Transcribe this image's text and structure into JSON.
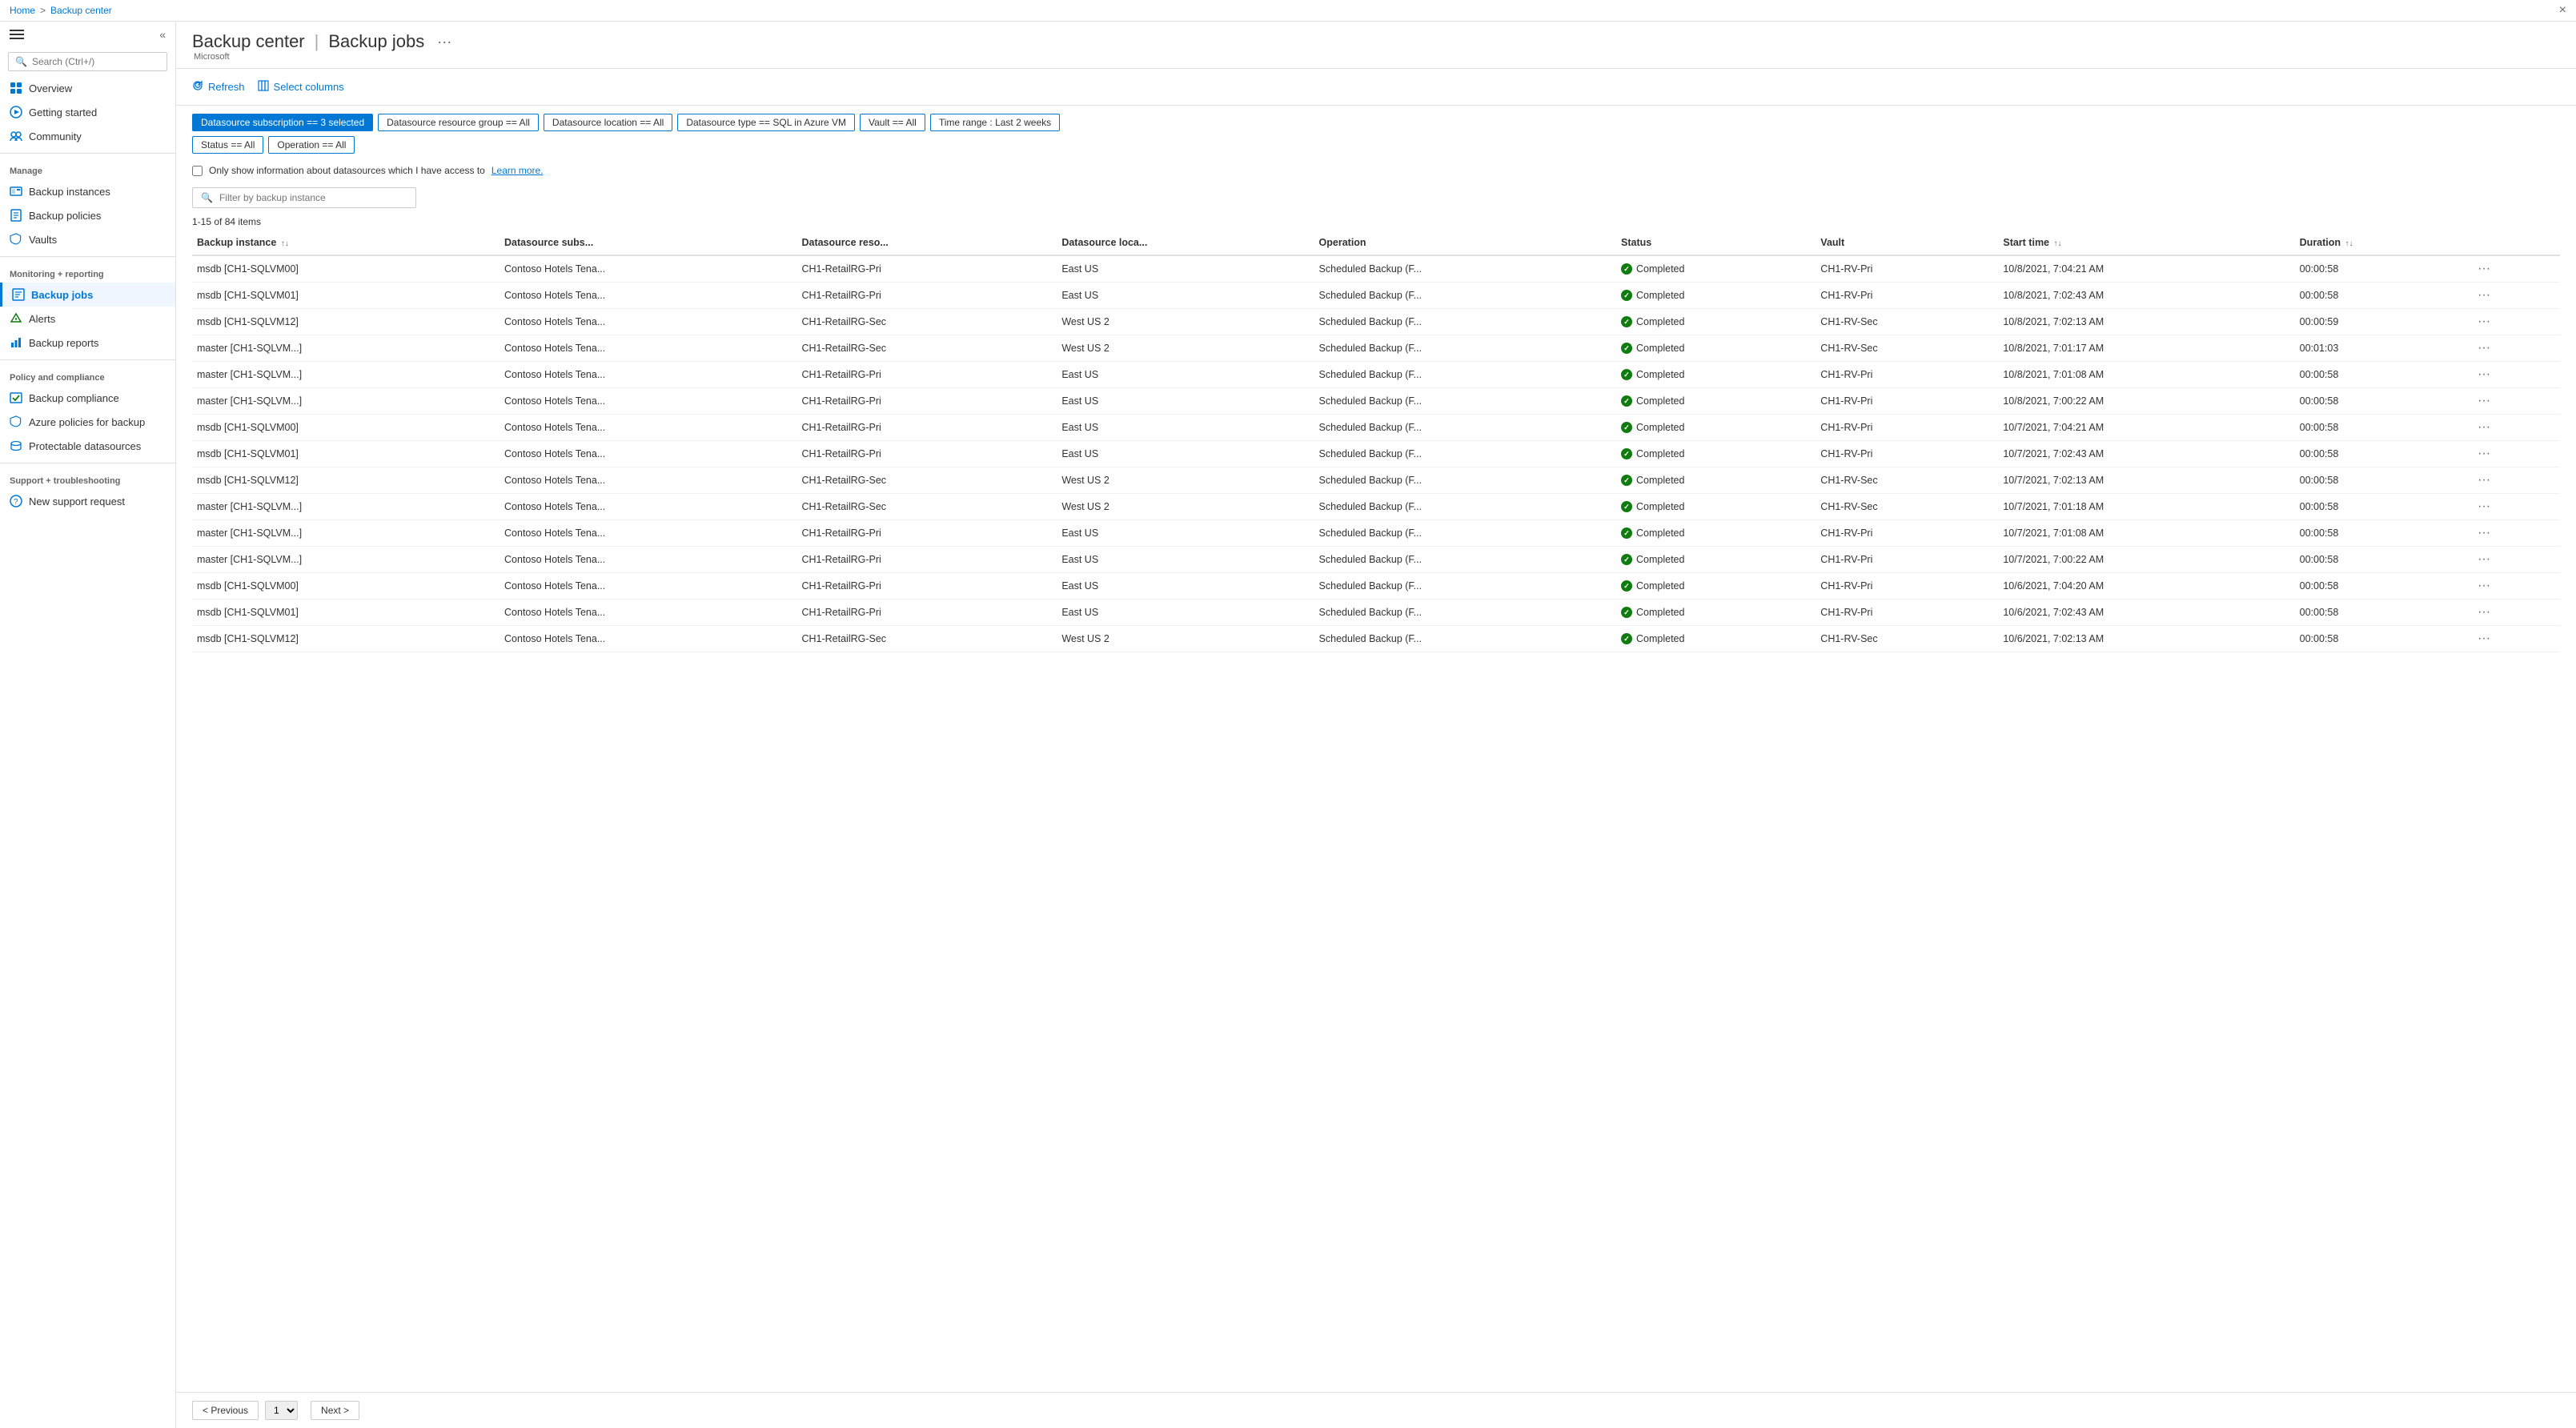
{
  "breadcrumb": {
    "home": "Home",
    "separator": ">",
    "current": "Backup center"
  },
  "close_button": "×",
  "page": {
    "title": "Backup center | Backup jobs",
    "title_part1": "Backup center",
    "separator": "|",
    "title_part2": "Backup jobs",
    "subtitle": "Microsoft",
    "more": "···"
  },
  "toolbar": {
    "refresh_label": "Refresh",
    "select_columns_label": "Select columns"
  },
  "filters": [
    {
      "label": "Datasource subscription == 3 selected",
      "active": true
    },
    {
      "label": "Datasource resource group == All",
      "active": false
    },
    {
      "label": "Datasource location == All",
      "active": false
    },
    {
      "label": "Datasource type == SQL in Azure VM",
      "active": false
    },
    {
      "label": "Vault == All",
      "active": false
    },
    {
      "label": "Time range : Last 2 weeks",
      "active": false
    },
    {
      "label": "Status == All",
      "active": false
    },
    {
      "label": "Operation == All",
      "active": false
    }
  ],
  "checkbox": {
    "label": "Only show information about datasources which I have access to",
    "link_text": "Learn more."
  },
  "filter_input": {
    "placeholder": "Filter by backup instance"
  },
  "count": "1-15 of 84 items",
  "table": {
    "columns": [
      {
        "label": "Backup instance",
        "sort": true
      },
      {
        "label": "Datasource subs...",
        "sort": false
      },
      {
        "label": "Datasource reso...",
        "sort": false
      },
      {
        "label": "Datasource loca...",
        "sort": false
      },
      {
        "label": "Operation",
        "sort": false
      },
      {
        "label": "Status",
        "sort": false
      },
      {
        "label": "Vault",
        "sort": false
      },
      {
        "label": "Start time",
        "sort": true
      },
      {
        "label": "Duration",
        "sort": true
      },
      {
        "label": "",
        "sort": false
      }
    ],
    "rows": [
      {
        "instance": "msdb [CH1-SQLVM00]",
        "subs": "Contoso Hotels Tena...",
        "rg": "CH1-RetailRG-Pri",
        "location": "East US",
        "operation": "Scheduled Backup (F...",
        "status": "Completed",
        "vault": "CH1-RV-Pri",
        "start_time": "10/8/2021, 7:04:21 AM",
        "duration": "00:00:58"
      },
      {
        "instance": "msdb [CH1-SQLVM01]",
        "subs": "Contoso Hotels Tena...",
        "rg": "CH1-RetailRG-Pri",
        "location": "East US",
        "operation": "Scheduled Backup (F...",
        "status": "Completed",
        "vault": "CH1-RV-Pri",
        "start_time": "10/8/2021, 7:02:43 AM",
        "duration": "00:00:58"
      },
      {
        "instance": "msdb [CH1-SQLVM12]",
        "subs": "Contoso Hotels Tena...",
        "rg": "CH1-RetailRG-Sec",
        "location": "West US 2",
        "operation": "Scheduled Backup (F...",
        "status": "Completed",
        "vault": "CH1-RV-Sec",
        "start_time": "10/8/2021, 7:02:13 AM",
        "duration": "00:00:59"
      },
      {
        "instance": "master [CH1-SQLVM...]",
        "subs": "Contoso Hotels Tena...",
        "rg": "CH1-RetailRG-Sec",
        "location": "West US 2",
        "operation": "Scheduled Backup (F...",
        "status": "Completed",
        "vault": "CH1-RV-Sec",
        "start_time": "10/8/2021, 7:01:17 AM",
        "duration": "00:01:03"
      },
      {
        "instance": "master [CH1-SQLVM...]",
        "subs": "Contoso Hotels Tena...",
        "rg": "CH1-RetailRG-Pri",
        "location": "East US",
        "operation": "Scheduled Backup (F...",
        "status": "Completed",
        "vault": "CH1-RV-Pri",
        "start_time": "10/8/2021, 7:01:08 AM",
        "duration": "00:00:58"
      },
      {
        "instance": "master [CH1-SQLVM...]",
        "subs": "Contoso Hotels Tena...",
        "rg": "CH1-RetailRG-Pri",
        "location": "East US",
        "operation": "Scheduled Backup (F...",
        "status": "Completed",
        "vault": "CH1-RV-Pri",
        "start_time": "10/8/2021, 7:00:22 AM",
        "duration": "00:00:58"
      },
      {
        "instance": "msdb [CH1-SQLVM00]",
        "subs": "Contoso Hotels Tena...",
        "rg": "CH1-RetailRG-Pri",
        "location": "East US",
        "operation": "Scheduled Backup (F...",
        "status": "Completed",
        "vault": "CH1-RV-Pri",
        "start_time": "10/7/2021, 7:04:21 AM",
        "duration": "00:00:58"
      },
      {
        "instance": "msdb [CH1-SQLVM01]",
        "subs": "Contoso Hotels Tena...",
        "rg": "CH1-RetailRG-Pri",
        "location": "East US",
        "operation": "Scheduled Backup (F...",
        "status": "Completed",
        "vault": "CH1-RV-Pri",
        "start_time": "10/7/2021, 7:02:43 AM",
        "duration": "00:00:58"
      },
      {
        "instance": "msdb [CH1-SQLVM12]",
        "subs": "Contoso Hotels Tena...",
        "rg": "CH1-RetailRG-Sec",
        "location": "West US 2",
        "operation": "Scheduled Backup (F...",
        "status": "Completed",
        "vault": "CH1-RV-Sec",
        "start_time": "10/7/2021, 7:02:13 AM",
        "duration": "00:00:58"
      },
      {
        "instance": "master [CH1-SQLVM...]",
        "subs": "Contoso Hotels Tena...",
        "rg": "CH1-RetailRG-Sec",
        "location": "West US 2",
        "operation": "Scheduled Backup (F...",
        "status": "Completed",
        "vault": "CH1-RV-Sec",
        "start_time": "10/7/2021, 7:01:18 AM",
        "duration": "00:00:58"
      },
      {
        "instance": "master [CH1-SQLVM...]",
        "subs": "Contoso Hotels Tena...",
        "rg": "CH1-RetailRG-Pri",
        "location": "East US",
        "operation": "Scheduled Backup (F...",
        "status": "Completed",
        "vault": "CH1-RV-Pri",
        "start_time": "10/7/2021, 7:01:08 AM",
        "duration": "00:00:58"
      },
      {
        "instance": "master [CH1-SQLVM...]",
        "subs": "Contoso Hotels Tena...",
        "rg": "CH1-RetailRG-Pri",
        "location": "East US",
        "operation": "Scheduled Backup (F...",
        "status": "Completed",
        "vault": "CH1-RV-Pri",
        "start_time": "10/7/2021, 7:00:22 AM",
        "duration": "00:00:58"
      },
      {
        "instance": "msdb [CH1-SQLVM00]",
        "subs": "Contoso Hotels Tena...",
        "rg": "CH1-RetailRG-Pri",
        "location": "East US",
        "operation": "Scheduled Backup (F...",
        "status": "Completed",
        "vault": "CH1-RV-Pri",
        "start_time": "10/6/2021, 7:04:20 AM",
        "duration": "00:00:58"
      },
      {
        "instance": "msdb [CH1-SQLVM01]",
        "subs": "Contoso Hotels Tena...",
        "rg": "CH1-RetailRG-Pri",
        "location": "East US",
        "operation": "Scheduled Backup (F...",
        "status": "Completed",
        "vault": "CH1-RV-Pri",
        "start_time": "10/6/2021, 7:02:43 AM",
        "duration": "00:00:58"
      },
      {
        "instance": "msdb [CH1-SQLVM12]",
        "subs": "Contoso Hotels Tena...",
        "rg": "CH1-RetailRG-Sec",
        "location": "West US 2",
        "operation": "Scheduled Backup (F...",
        "status": "Completed",
        "vault": "CH1-RV-Sec",
        "start_time": "10/6/2021, 7:02:13 AM",
        "duration": "00:00:58"
      }
    ]
  },
  "pagination": {
    "prev_label": "< Previous",
    "next_label": "Next >",
    "current_page": "1"
  },
  "sidebar": {
    "search_placeholder": "Search (Ctrl+/)",
    "collapse_title": "«",
    "sections": [
      {
        "items": [
          {
            "label": "Overview",
            "icon": "🏠",
            "active": false,
            "id": "overview"
          },
          {
            "label": "Getting started",
            "icon": "🚀",
            "active": false,
            "id": "getting-started"
          },
          {
            "label": "Community",
            "icon": "👥",
            "active": false,
            "id": "community"
          }
        ]
      },
      {
        "label": "Manage",
        "items": [
          {
            "label": "Backup instances",
            "icon": "💾",
            "active": false,
            "id": "backup-instances"
          },
          {
            "label": "Backup policies",
            "icon": "📋",
            "active": false,
            "id": "backup-policies"
          },
          {
            "label": "Vaults",
            "icon": "🔒",
            "active": false,
            "id": "vaults"
          }
        ]
      },
      {
        "label": "Monitoring + reporting",
        "items": [
          {
            "label": "Backup jobs",
            "icon": "📊",
            "active": true,
            "id": "backup-jobs"
          },
          {
            "label": "Alerts",
            "icon": "🔔",
            "active": false,
            "id": "alerts"
          },
          {
            "label": "Backup reports",
            "icon": "📈",
            "active": false,
            "id": "backup-reports"
          }
        ]
      },
      {
        "label": "Policy and compliance",
        "items": [
          {
            "label": "Backup compliance",
            "icon": "✅",
            "active": false,
            "id": "backup-compliance"
          },
          {
            "label": "Azure policies for backup",
            "icon": "🛡️",
            "active": false,
            "id": "azure-policies"
          },
          {
            "label": "Protectable datasources",
            "icon": "🗄️",
            "active": false,
            "id": "protectable-datasources"
          }
        ]
      },
      {
        "label": "Support + troubleshooting",
        "items": [
          {
            "label": "New support request",
            "icon": "❓",
            "active": false,
            "id": "new-support"
          }
        ]
      }
    ]
  }
}
